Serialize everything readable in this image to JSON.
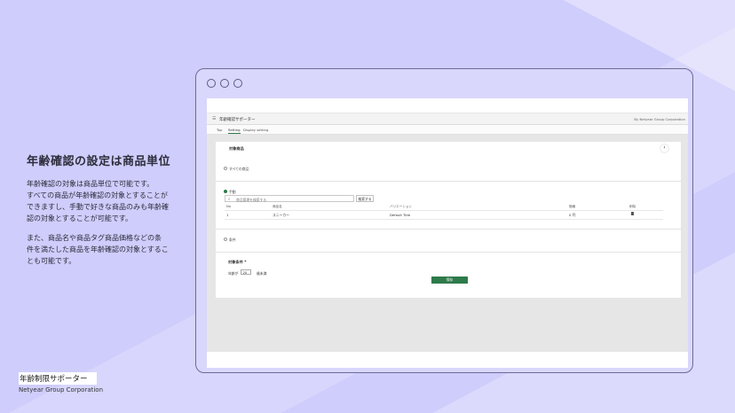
{
  "slide": {
    "heading": "年齢確認の設定は商品単位",
    "para1": [
      "年齢確認の対象は商品単位で可能です。",
      "すべての商品が年齢確認の対象とすることが",
      "できますし、手動で好きな商品のみも年齢確",
      "認の対象とすることが可能です。"
    ],
    "para2": [
      "また、商品名や商品タグ商品価格などの条",
      "件を満たした商品を年齢確認の対象とするこ",
      "とも可能です。"
    ],
    "footer_title": "年齢制限サポーター",
    "footer_corp": "Netyear Group Corporation"
  },
  "app": {
    "title": "年齢確認サポーター",
    "corp": "By Netyear Group Corporation",
    "tabs": [
      "Top",
      "Setting",
      "Display setting"
    ],
    "panel_title": "対象商品",
    "options": {
      "all": "すべての商品",
      "manual": "手動",
      "conditional": "条件"
    },
    "search": {
      "placeholder": "商品管理を検索する",
      "button": "検索する"
    },
    "table": {
      "headers": [
        "No",
        "商品名",
        "バリエーション",
        "価格",
        "削除"
      ],
      "rows": [
        {
          "no": "1",
          "name": "スニーカー",
          "variation": "Default Title",
          "price": "0 円"
        }
      ]
    },
    "condition": {
      "title": "対象条件 *",
      "label": "年齢が",
      "value": "20",
      "unit": "歳未満"
    },
    "save_label": "保存"
  },
  "colors": {
    "background": "#cfcdfb",
    "accent_green": "#2e7a4a"
  }
}
